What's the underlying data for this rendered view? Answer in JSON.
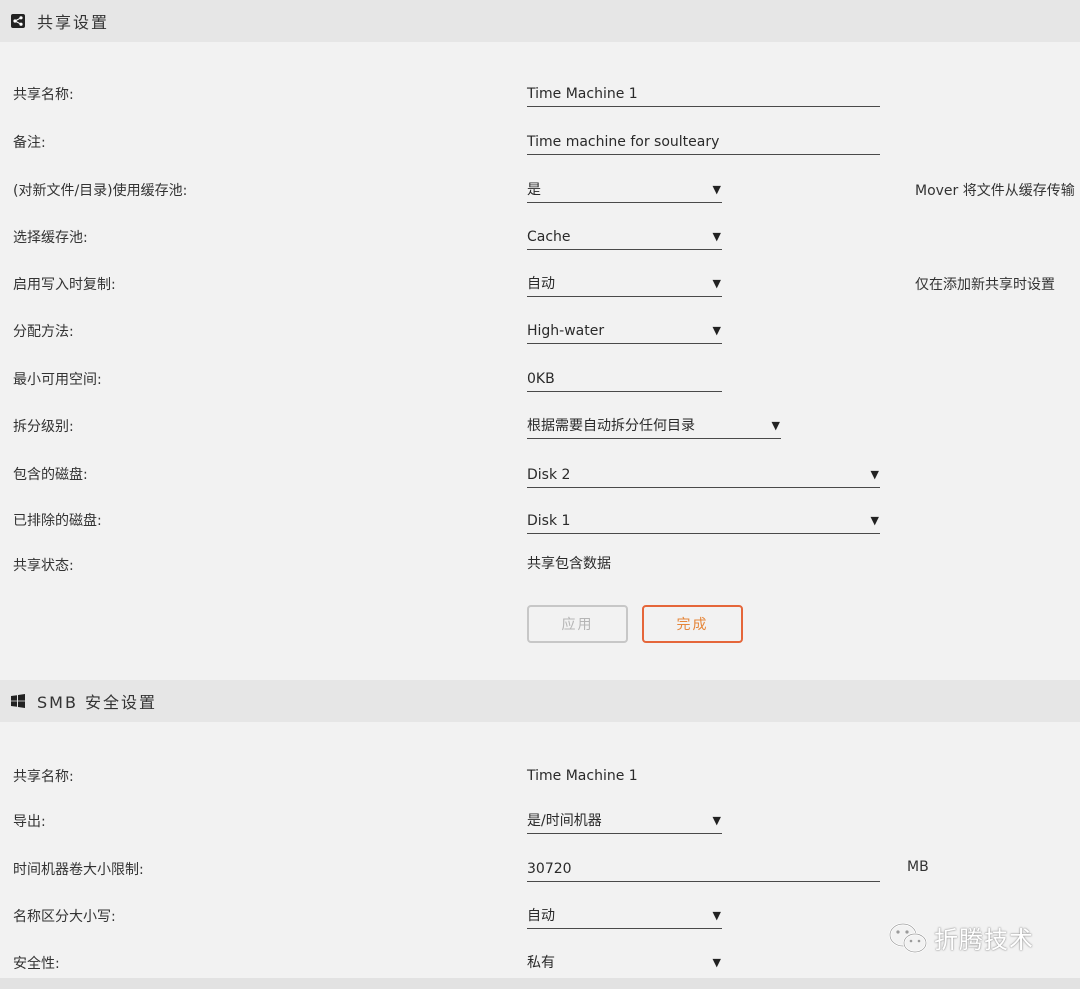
{
  "share_settings": {
    "title": "共享设置",
    "rows": [
      {
        "label": "共享名称:",
        "value": "Time Machine 1"
      },
      {
        "label": "备注:",
        "value": "Time machine for soulteary"
      },
      {
        "label": "(对新文件/目录)使用缓存池:",
        "value": "是",
        "note": "Mover 将文件从缓存传输"
      },
      {
        "label": "选择缓存池:",
        "value": "Cache"
      },
      {
        "label": "启用写入时复制:",
        "value": "自动",
        "note": "仅在添加新共享时设置"
      },
      {
        "label": "分配方法:",
        "value": "High-water"
      },
      {
        "label": "最小可用空间:",
        "value": "0KB"
      },
      {
        "label": "拆分级别:",
        "value": "根据需要自动拆分任何目录"
      },
      {
        "label": "包含的磁盘:",
        "value": "Disk 2"
      },
      {
        "label": "已排除的磁盘:",
        "value": "Disk 1"
      },
      {
        "label": "共享状态:",
        "value": "共享包含数据"
      }
    ],
    "apply_label": "应用",
    "done_label": "完成"
  },
  "smb_settings": {
    "title": "SMB 安全设置",
    "rows": [
      {
        "label": "共享名称:",
        "value": "Time Machine 1"
      },
      {
        "label": "导出:",
        "value": "是/时间机器"
      },
      {
        "label": "时间机器卷大小限制:",
        "value": "30720",
        "unit": "MB"
      },
      {
        "label": "名称区分大小写:",
        "value": "自动"
      },
      {
        "label": "安全性:",
        "value": "私有"
      }
    ]
  },
  "dropdown_arrow": "▼",
  "watermark": "折腾技术",
  "icons": {
    "share": "share-icon",
    "windows": "windows-icon",
    "wechat": "wechat-icon"
  },
  "colors": {
    "accent": "#e5663a",
    "header_bg": "#e6e6e6",
    "page_bg": "#f2f2f2"
  }
}
